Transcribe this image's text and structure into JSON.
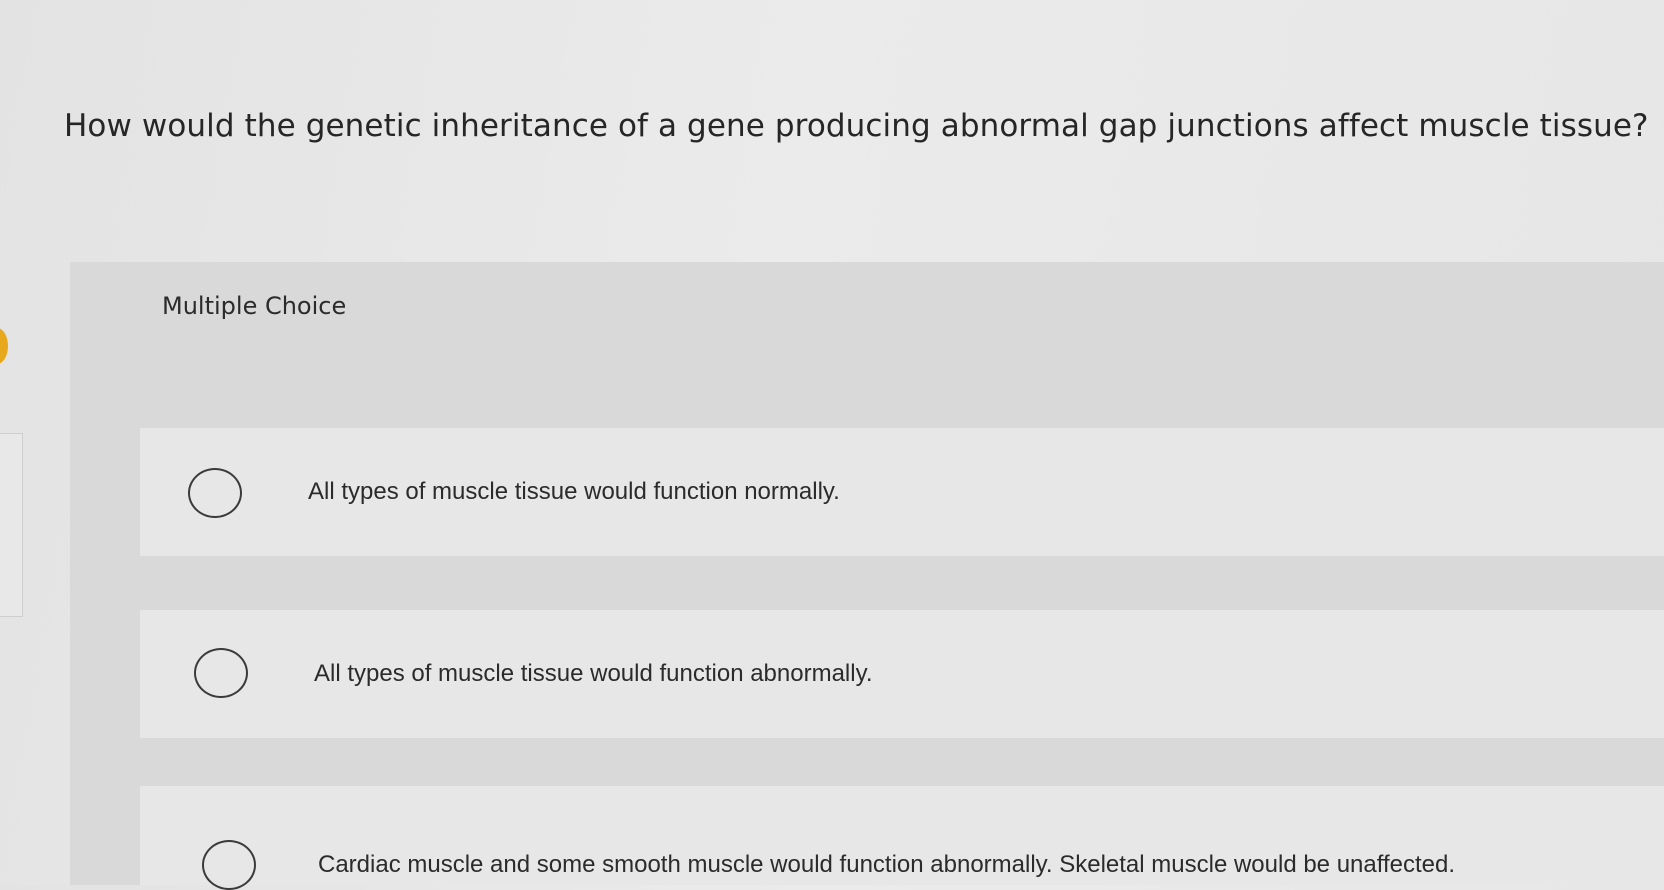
{
  "question": {
    "text": "How would the genetic inheritance of a gene producing abnormal gap junctions affect muscle tissue?"
  },
  "panel": {
    "title": "Multiple Choice"
  },
  "choices": [
    {
      "text": "All types of muscle tissue would function normally.",
      "selected": false
    },
    {
      "text": "All types of muscle tissue would function abnormally.",
      "selected": false
    },
    {
      "text": "Cardiac muscle and some smooth muscle would function abnormally. Skeletal muscle would be unaffected.",
      "selected": false
    }
  ],
  "colors": {
    "accent": "#e8a81c"
  }
}
